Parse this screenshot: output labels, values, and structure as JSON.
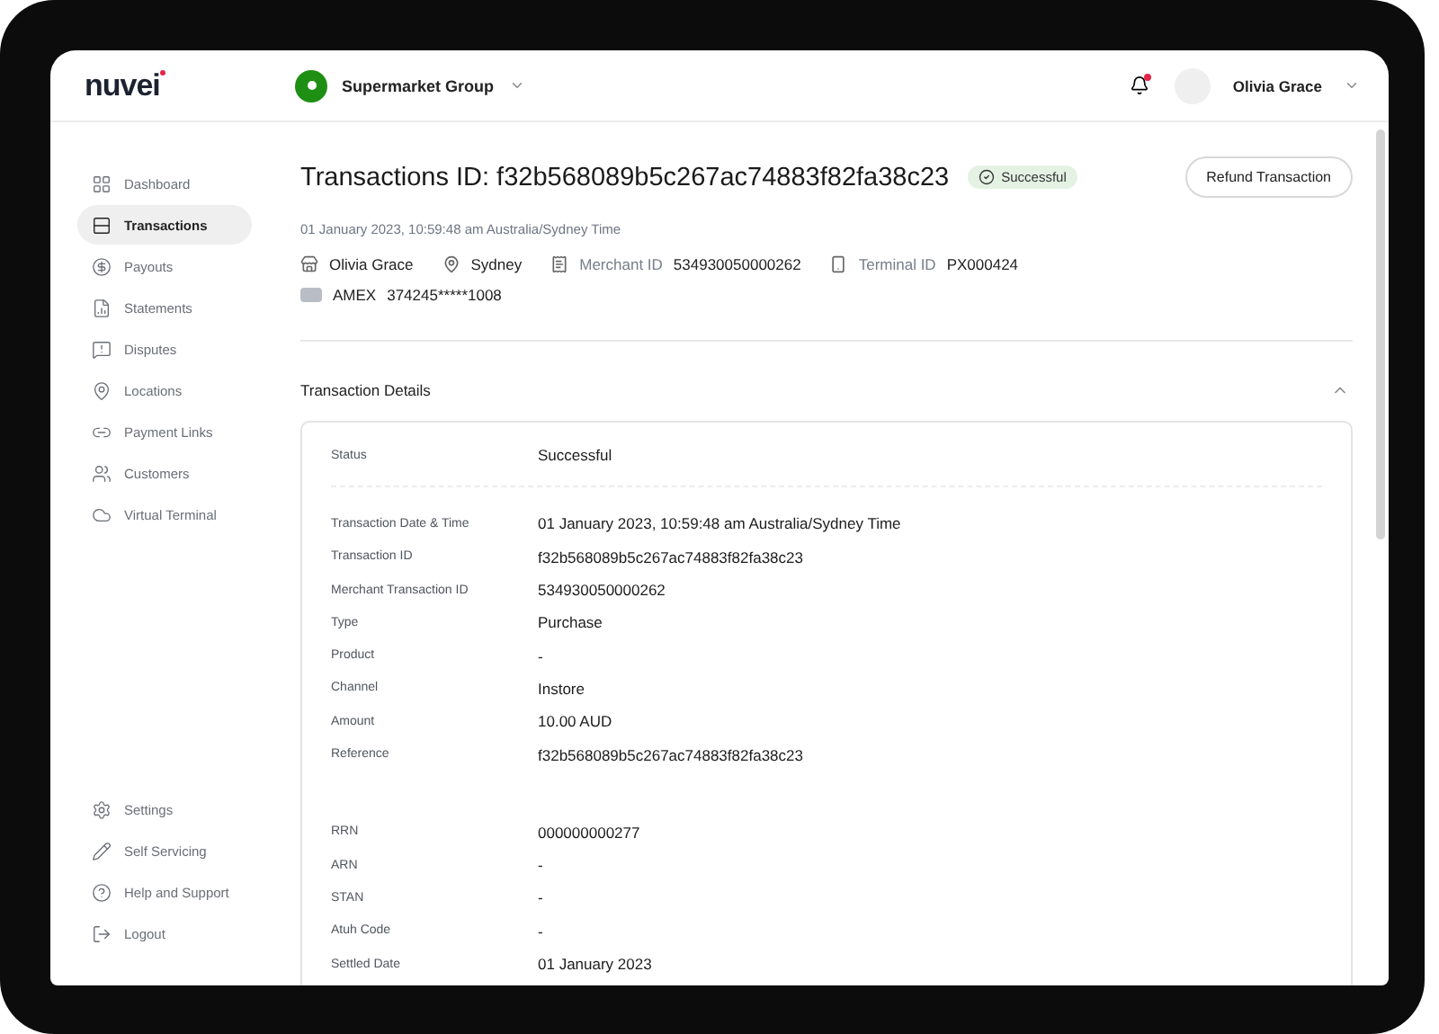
{
  "header": {
    "logo": "nuvei",
    "organization": "Supermarket Group",
    "notifications_unread": true,
    "user_name": "Olivia Grace"
  },
  "sidebar": {
    "items": [
      {
        "label": "Dashboard",
        "selected": false
      },
      {
        "label": "Transactions",
        "selected": true
      },
      {
        "label": "Payouts",
        "selected": false
      },
      {
        "label": "Statements",
        "selected": false
      },
      {
        "label": "Disputes",
        "selected": false
      },
      {
        "label": "Locations",
        "selected": false
      },
      {
        "label": "Payment Links",
        "selected": false
      },
      {
        "label": "Customers",
        "selected": false
      },
      {
        "label": "Virtual Terminal",
        "selected": false
      }
    ],
    "bottom_items": [
      {
        "label": "Settings",
        "selected": false
      },
      {
        "label": "Self Servicing",
        "selected": false
      },
      {
        "label": "Help and Support",
        "selected": false
      },
      {
        "label": "Logout",
        "selected": false
      }
    ]
  },
  "transaction": {
    "title": "Transactions ID: f32b568089b5c267ac74883f82fa38c23",
    "status": "Successful",
    "refund_button": "Refund Transaction",
    "datetime": "01 January 2023, 10:59:48 am Australia/Sydney Time",
    "customer": "Olivia Grace",
    "location": "Sydney",
    "merchant_id_label": "Merchant ID",
    "merchant_id": "534930050000262",
    "terminal_id_label": "Terminal ID",
    "terminal_id": "PX000424",
    "card_brand": "AMEX",
    "card_number": "374245*****1008"
  },
  "details": {
    "title": "Transaction Details",
    "expanded": true,
    "groups": [
      [
        {
          "label": "Status",
          "value": "Successful"
        }
      ],
      [
        {
          "label": "Transaction Date & Time",
          "value": "01 January 2023, 10:59:48 am Australia/Sydney Time"
        },
        {
          "label": "Transaction ID",
          "value": "f32b568089b5c267ac74883f82fa38c23"
        },
        {
          "label": "Merchant Transaction ID",
          "value": "534930050000262"
        },
        {
          "label": "Type",
          "value": "Purchase"
        },
        {
          "label": "Product",
          "value": "-"
        },
        {
          "label": "Channel",
          "value": "Instore"
        },
        {
          "label": "Amount",
          "value": "10.00 AUD"
        },
        {
          "label": "Reference",
          "value": "f32b568089b5c267ac74883f82fa38c23"
        }
      ],
      [
        {
          "label": "RRN",
          "value": "000000000277"
        },
        {
          "label": "ARN",
          "value": "-"
        },
        {
          "label": "STAN",
          "value": "-"
        },
        {
          "label": "Atuh Code",
          "value": "-"
        },
        {
          "label": "Settled Date",
          "value": "01 January 2023"
        }
      ]
    ]
  }
}
